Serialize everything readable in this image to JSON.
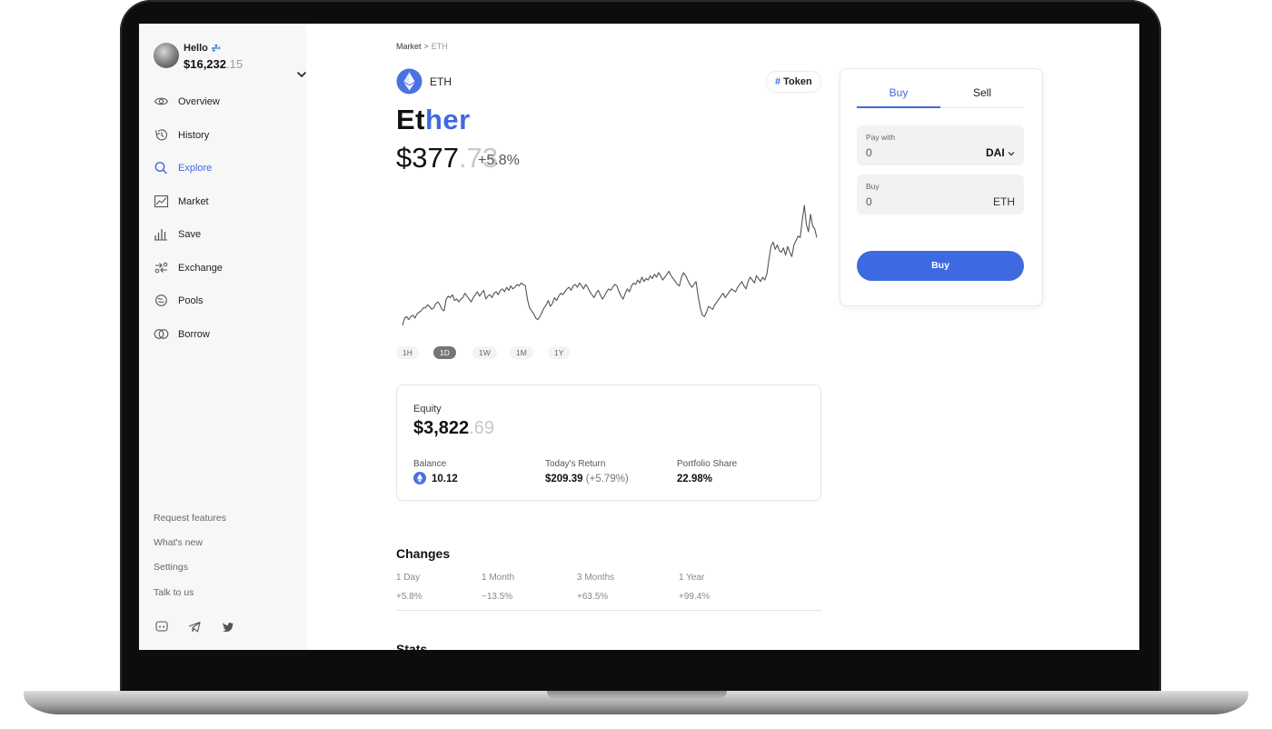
{
  "account": {
    "greeting": "Hello",
    "greeting_emoji": "💤",
    "balance_main": "$16,232",
    "balance_cents": ".15"
  },
  "sidebar": {
    "items": [
      {
        "label": "Overview",
        "icon": "eye-icon"
      },
      {
        "label": "History",
        "icon": "history-icon"
      },
      {
        "label": "Explore",
        "icon": "search-icon",
        "active": true
      },
      {
        "label": "Market",
        "icon": "chart-icon"
      },
      {
        "label": "Save",
        "icon": "bars-icon"
      },
      {
        "label": "Exchange",
        "icon": "exchange-icon"
      },
      {
        "label": "Pools",
        "icon": "pools-icon"
      },
      {
        "label": "Borrow",
        "icon": "borrow-icon"
      }
    ],
    "footer_links": [
      "Request features",
      "What's new",
      "Settings",
      "Talk to us"
    ],
    "social": [
      "discord-icon",
      "telegram-icon",
      "twitter-icon"
    ]
  },
  "breadcrumb": {
    "parent": "Market",
    "separator": ">",
    "current": "ETH"
  },
  "asset": {
    "ticker": "ETH",
    "tag_hash": "#",
    "tag": "Token",
    "name_part1": "Et",
    "name_part2": "her",
    "price_main": "$377",
    "price_dec": ".73",
    "change": "+5.8%"
  },
  "chart_data": {
    "type": "line",
    "series": [
      {
        "values": [
          10,
          15,
          16,
          14,
          16,
          17,
          15,
          18,
          19,
          20,
          22,
          22,
          24,
          23,
          21,
          22,
          25,
          26,
          24,
          21,
          20,
          28,
          30,
          29,
          31,
          27,
          28,
          26,
          28,
          29,
          32,
          30,
          28,
          26,
          29,
          31,
          33,
          30,
          32,
          34,
          28,
          30,
          31,
          29,
          32,
          33,
          31,
          34,
          35,
          33,
          36,
          34,
          37,
          35,
          36,
          38,
          37,
          39,
          38,
          37,
          28,
          22,
          20,
          18,
          15,
          14,
          16,
          19,
          22,
          24,
          27,
          23,
          25,
          29,
          27,
          30,
          32,
          31,
          33,
          35,
          36,
          34,
          37,
          38,
          36,
          39,
          37,
          35,
          38,
          36,
          33,
          31,
          29,
          32,
          34,
          31,
          28,
          30,
          33,
          35,
          34,
          36,
          38,
          37,
          33,
          30,
          28,
          32,
          35,
          33,
          37,
          39,
          38,
          41,
          39,
          43,
          40,
          42,
          41,
          44,
          42,
          45,
          43,
          46,
          44,
          41,
          43,
          45,
          47,
          44,
          42,
          40,
          38,
          37,
          43,
          46,
          44,
          41,
          38,
          36,
          38,
          40,
          30,
          22,
          17,
          16,
          19,
          23,
          22,
          21,
          24,
          26,
          28,
          30,
          32,
          29,
          31,
          33,
          35,
          34,
          33,
          36,
          38,
          40,
          37,
          35,
          40,
          43,
          41,
          39,
          44,
          42,
          40,
          43,
          41,
          45,
          55,
          64,
          67,
          62,
          65,
          61,
          60,
          63,
          58,
          64,
          60,
          57,
          65,
          68,
          71,
          70,
          82,
          92,
          79,
          74,
          86,
          78,
          76,
          70
        ]
      }
    ],
    "color": "#555555",
    "axes_visible": false
  },
  "ranges": [
    {
      "label": "1H"
    },
    {
      "label": "1D",
      "active": true
    },
    {
      "label": "1W"
    },
    {
      "label": "1M"
    },
    {
      "label": "1Y"
    }
  ],
  "equity": {
    "label": "Equity",
    "value_main": "$3,822",
    "value_dec": ".69",
    "balance_label": "Balance",
    "balance_value": "10.12",
    "return_label": "Today's Return",
    "return_value": "$209.39",
    "return_pct": "(+5.79%)",
    "share_label": "Portfolio Share",
    "share_value": "22.98%"
  },
  "changes": {
    "title": "Changes",
    "columns": [
      {
        "label": "1 Day",
        "value": "+5.8%"
      },
      {
        "label": "1 Month",
        "value": "−13.5%"
      },
      {
        "label": "3 Months",
        "value": "+63.5%"
      },
      {
        "label": "1 Year",
        "value": "+99.4%"
      }
    ]
  },
  "stats_title": "Stats",
  "trade": {
    "tab_buy": "Buy",
    "tab_sell": "Sell",
    "pay_label": "Pay with",
    "pay_value": "0",
    "pay_asset": "DAI",
    "buy_label": "Buy",
    "buy_value": "0",
    "buy_asset": "ETH",
    "button": "Buy"
  },
  "colors": {
    "accent": "#3e6ae1",
    "sidebar_bg": "#f7f7f7",
    "chart_line": "#555555"
  }
}
